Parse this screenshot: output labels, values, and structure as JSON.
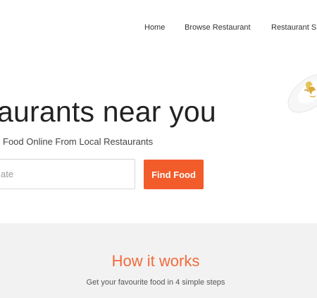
{
  "nav": {
    "items": [
      {
        "label": "Home"
      },
      {
        "label": "Browse Restaurant"
      },
      {
        "label": "Restaurant S"
      }
    ]
  },
  "hero": {
    "title": "aurants near you",
    "subtitle": "Food Online From Local Restaurants",
    "search": {
      "placeholder": "ate"
    },
    "find_button_label": "Find Food"
  },
  "how_it_works": {
    "title": "How it works",
    "subtitle": "Get your favourite food in 4 simple steps"
  },
  "colors": {
    "accent": "#f25c2b",
    "section_bg": "#f2f2f2"
  },
  "icons": {
    "dish": "food-dish-icon"
  }
}
